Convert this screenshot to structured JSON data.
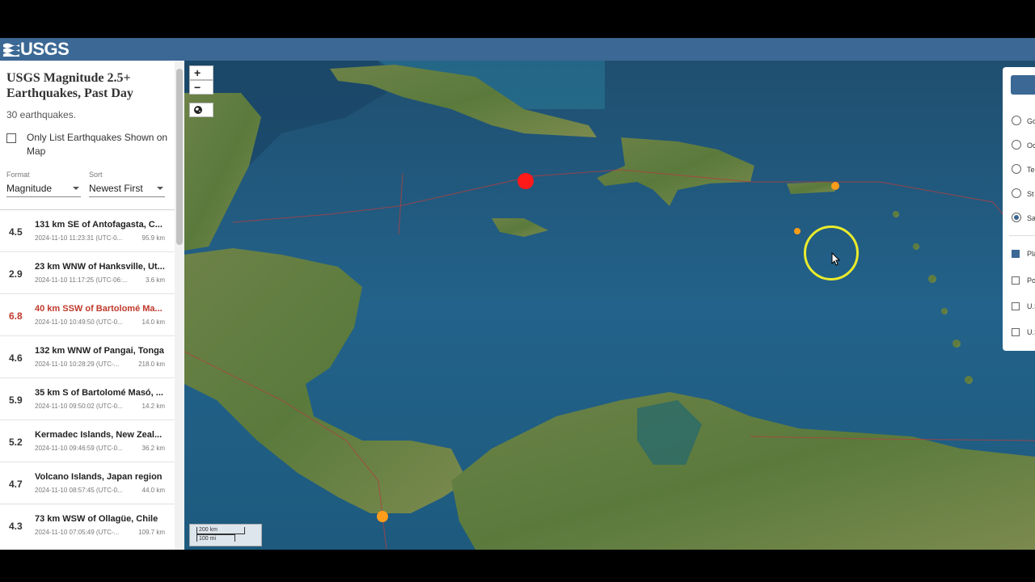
{
  "header": {
    "logo_text": "USGS"
  },
  "sidebar": {
    "title": "USGS Magnitude 2.5+ Earthquakes, Past Day",
    "count": "30 earthquakes.",
    "only_list_label": "Only List Earthquakes Shown on Map",
    "format_label": "Format",
    "format_value": "Magnitude",
    "sort_label": "Sort",
    "sort_value": "Newest First"
  },
  "earthquakes": [
    {
      "mag": "4.5",
      "place": "131 km SE of Antofagasta, C...",
      "time": "2024-11-10 11:23:31 (UTC-0...",
      "depth": "95.9 km"
    },
    {
      "mag": "2.9",
      "place": "23 km WNW of Hanksville, Ut...",
      "time": "2024-11-10 11:17:25 (UTC-06:...",
      "depth": "3.6 km"
    },
    {
      "mag": "6.8",
      "place": "40 km SSW of Bartolomé Ma...",
      "time": "2024-11-10 10:49:50 (UTC-0...",
      "depth": "14.0 km",
      "alert": true
    },
    {
      "mag": "4.6",
      "place": "132 km WNW of Pangai, Tonga",
      "time": "2024-11-10 10:28:29 (UTC-...",
      "depth": "218.0 km"
    },
    {
      "mag": "5.9",
      "place": "35 km S of Bartolomé Masó, ...",
      "time": "2024-11-10 09:50:02 (UTC-0...",
      "depth": "14.2 km"
    },
    {
      "mag": "5.2",
      "place": "Kermadec Islands, New Zeal...",
      "time": "2024-11-10 09:46:59 (UTC-0...",
      "depth": "36.2 km"
    },
    {
      "mag": "4.7",
      "place": "Volcano Islands, Japan region",
      "time": "2024-11-10 08:57:45 (UTC-0...",
      "depth": "44.0 km"
    },
    {
      "mag": "4.3",
      "place": "73 km WSW of Ollagüe, Chile",
      "time": "2024-11-10 07:05:49 (UTC-...",
      "depth": "109.7 km"
    }
  ],
  "map": {
    "zoom_in": "+",
    "zoom_out": "−",
    "scale_km": "200 km",
    "scale_mi": "100 mi"
  },
  "panel": {
    "radio_labels": [
      "Go",
      "Oc",
      "Te",
      "St",
      "Sa"
    ],
    "checkbox_labels": [
      "Pla",
      "Po",
      "U.S",
      "U.S"
    ]
  },
  "colors": {
    "header": "#3b6894",
    "alert": "#c0392b",
    "quake_major": "#ff1a1a",
    "quake_minor": "#ff9c1a"
  }
}
